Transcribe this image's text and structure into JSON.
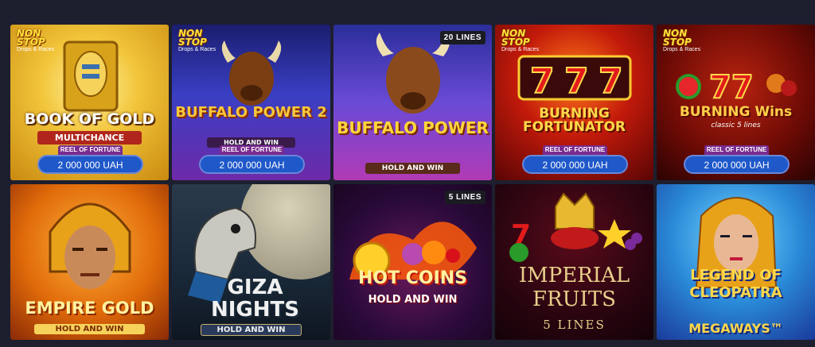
{
  "tiles": [
    {
      "title": "BOOK OF GOLD",
      "subtitle": "MULTICHANCE",
      "nonstop": {
        "main": "NON STOP",
        "sub": "Drops & Races"
      },
      "jackpot": {
        "label": "REEL OF FORTUNE",
        "amount": "2 000 000 UAH"
      }
    },
    {
      "title": "BUFFALO POWER 2",
      "subtitle": "HOLD AND WIN",
      "nonstop": {
        "main": "NON STOP",
        "sub": "Drops & Races"
      },
      "jackpot": {
        "label": "REEL OF FORTUNE",
        "amount": "2 000 000 UAH"
      }
    },
    {
      "title": "BUFFALO POWER",
      "subtitle": "HOLD AND WIN",
      "lines": "20 LINES"
    },
    {
      "title": "BURNING FORTUNATOR",
      "subtitle": "",
      "nonstop": {
        "main": "NON STOP",
        "sub": "Drops & Races"
      },
      "jackpot": {
        "label": "REEL OF FORTUNE",
        "amount": "2 000 000 UAH"
      }
    },
    {
      "title": "BURNING Wins",
      "subtitle": "classic 5 lines",
      "nonstop": {
        "main": "NON STOP",
        "sub": "Drops & Races"
      },
      "jackpot": {
        "label": "REEL OF FORTUNE",
        "amount": "2 000 000 UAH"
      }
    },
    {
      "title": "EMPIRE GOLD",
      "subtitle": "HOLD AND WIN"
    },
    {
      "title": "GIZA NIGHTS",
      "subtitle": "HOLD AND WIN"
    },
    {
      "title": "HOT COINS",
      "subtitle": "HOLD AND WIN",
      "lines": "5 LINES"
    },
    {
      "title": "IMPERIAL FRUITS",
      "subtitle": "5 LINES"
    },
    {
      "title": "LEGEND OF CLEOPATRA",
      "subtitle": "MEGAWAYS™"
    }
  ]
}
